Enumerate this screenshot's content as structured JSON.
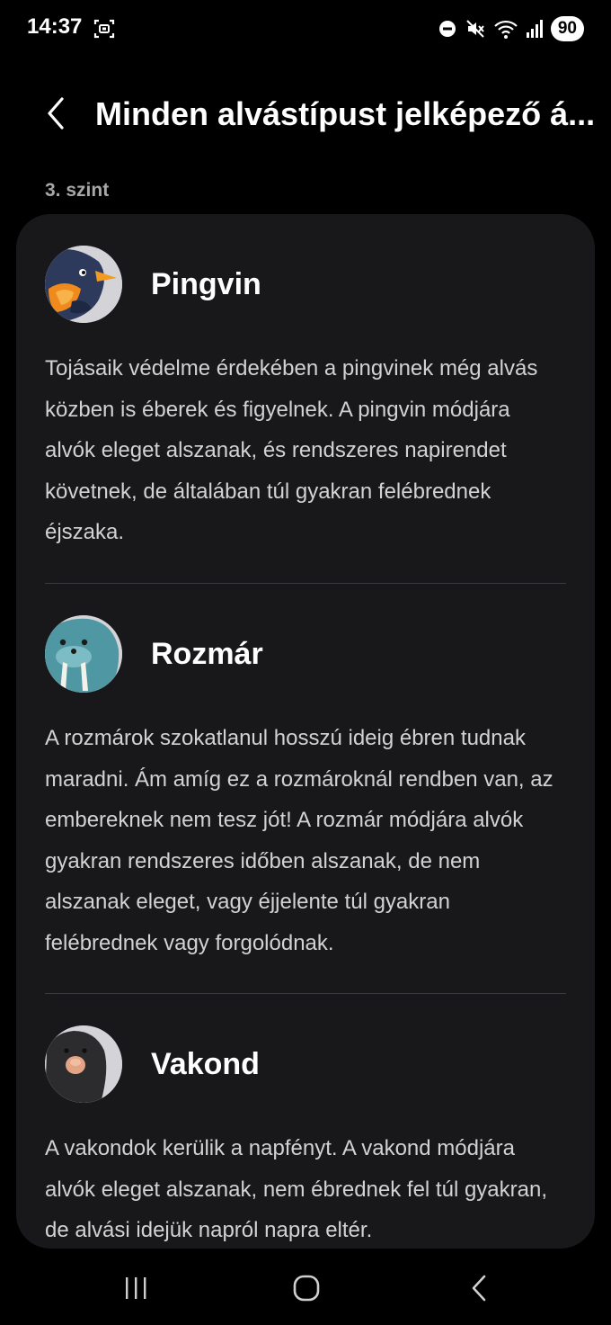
{
  "status_bar": {
    "time": "14:37",
    "battery": "90",
    "icons": [
      "screenshot-icon",
      "do-not-disturb-icon",
      "mute-icon",
      "wifi-icon",
      "signal-icon"
    ]
  },
  "header": {
    "title": "Minden alvástípust jelképező á..."
  },
  "section_label": "3. szint",
  "items": [
    {
      "name": "Pingvin",
      "icon": "penguin-avatar",
      "description": "Tojásaik védelme érdekében a pingvinek még alvás közben is éberek és figyelnek. A pingvin módjára alvók eleget alszanak, és rendszeres napirendet követnek, de általában túl gyakran felébrednek éjszaka."
    },
    {
      "name": "Rozmár",
      "icon": "walrus-avatar",
      "description": "A rozmárok szokatlanul hosszú ideig ébren tudnak maradni. Ám amíg ez a rozmároknál rendben van, az embereknek nem tesz jót! A rozmár módjára alvók gyakran rendszeres időben alszanak, de nem alszanak eleget, vagy éjjelente túl gyakran felébrednek vagy forgolódnak."
    },
    {
      "name": "Vakond",
      "icon": "mole-avatar",
      "description": "A vakondok kerülik a napfényt. A vakond módjára alvók eleget alszanak, nem ébrednek fel túl gyakran, de alvási idejük napról napra eltér."
    }
  ],
  "colors": {
    "background": "#000000",
    "card": "#18181b",
    "divider": "#3a3a3e",
    "secondary_text": "#a8a8a8"
  },
  "nav_bar": {
    "buttons": [
      "recent-apps-icon",
      "home-icon",
      "back-icon"
    ]
  }
}
